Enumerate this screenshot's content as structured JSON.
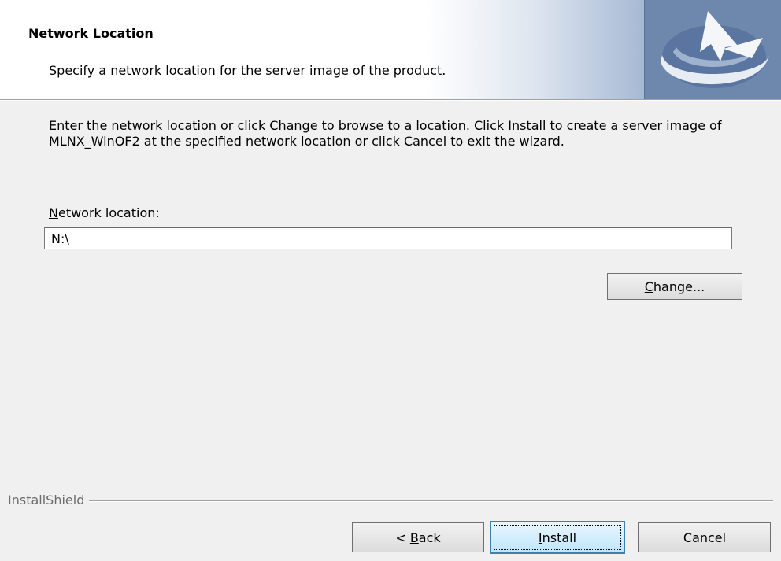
{
  "header": {
    "title": "Network Location",
    "subtitle": "Specify a network location for the server image of the product."
  },
  "body": {
    "description": "Enter the network location or click Change to browse to a location.  Click Install to create a server image of MLNX_WinOF2 at the specified network location or click Cancel to exit the wizard.",
    "field_label_mnemonic": "N",
    "field_label_rest": "etwork location:",
    "network_location_value": "N:\\"
  },
  "buttons": {
    "change_mnemonic": "C",
    "change_rest": "hange...",
    "back_prefix": "< ",
    "back_mnemonic": "B",
    "back_rest": "ack",
    "install_mnemonic": "I",
    "install_rest": "nstall",
    "cancel": "Cancel"
  },
  "footer": {
    "brand": "InstallShield"
  },
  "icons": {
    "header_logo": "installshield-logo-icon"
  },
  "colors": {
    "logo_background": "#6e88ad",
    "default_button_border": "#3c7fb1"
  }
}
